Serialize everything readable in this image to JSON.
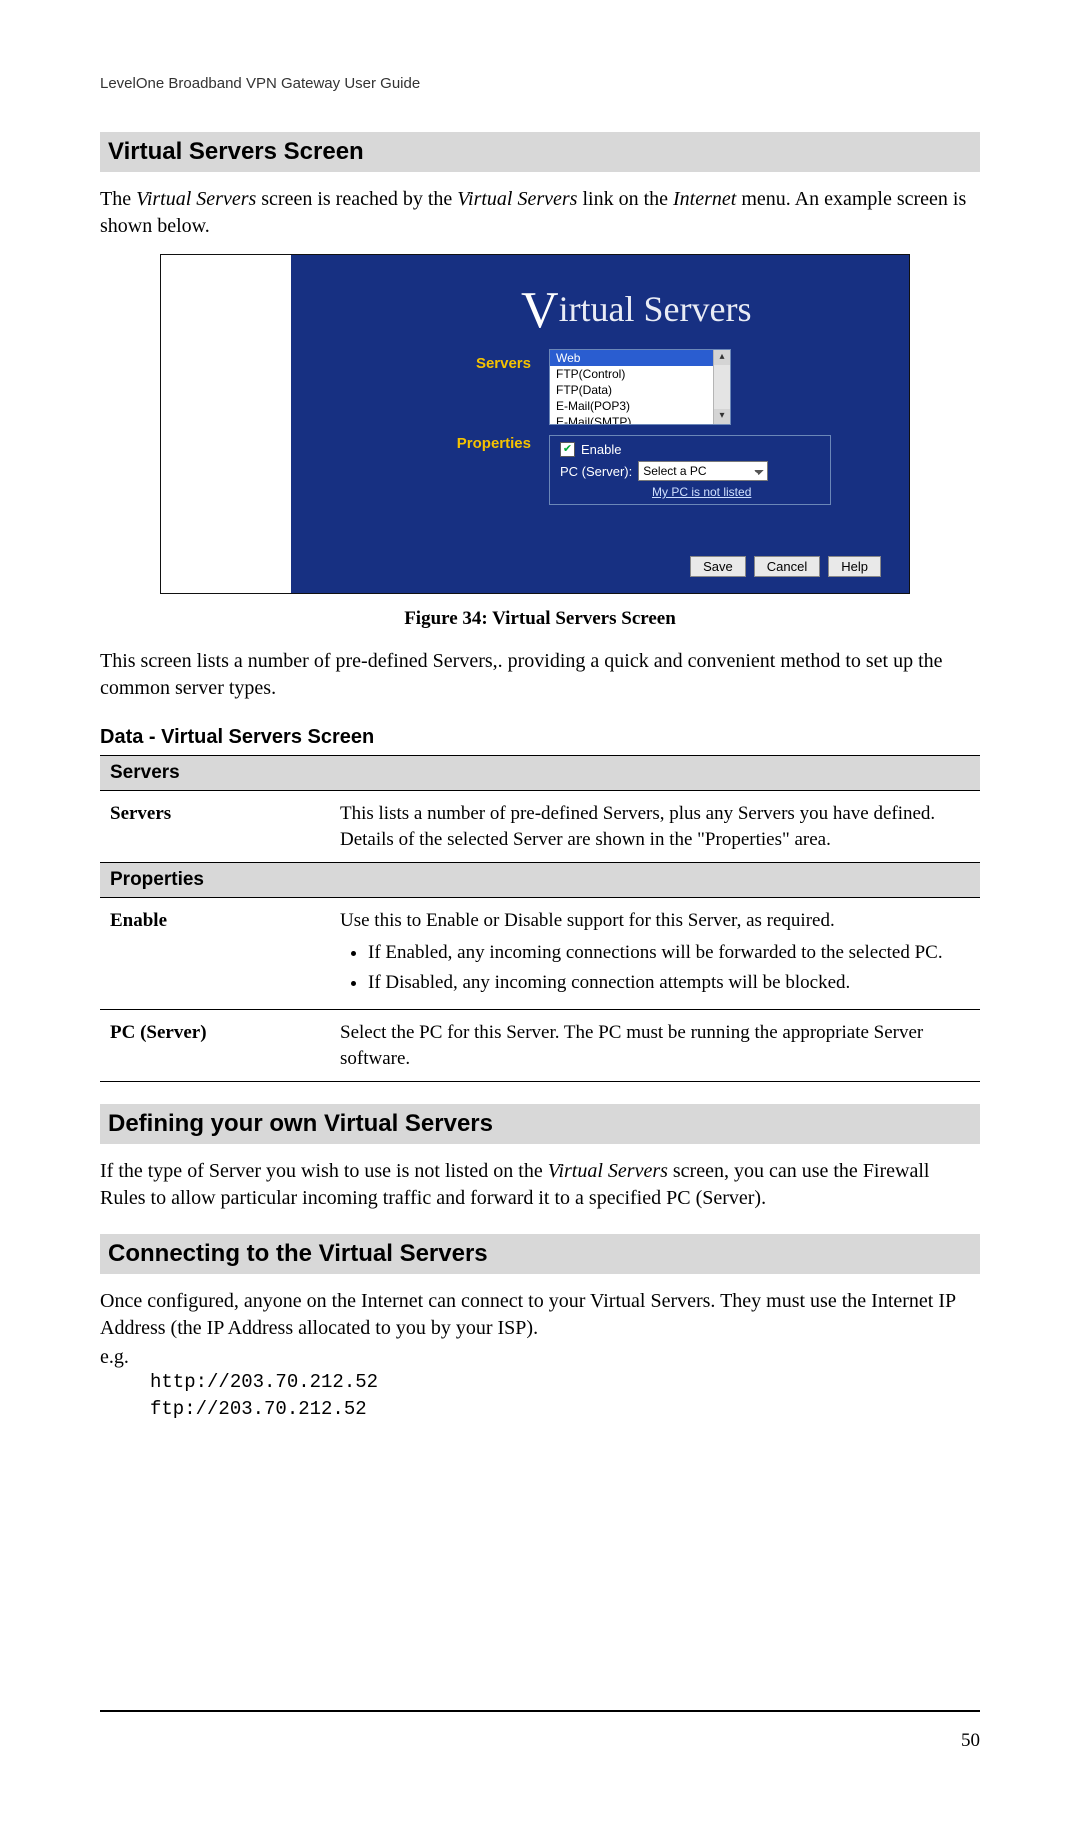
{
  "header": "LevelOne Broadband VPN Gateway User Guide",
  "page_number": "50",
  "sec1": {
    "title": "Virtual Servers Screen",
    "para_pre": "The ",
    "para_i1": "Virtual Servers",
    "para_mid": " screen is reached by the ",
    "para_i2": "Virtual Servers",
    "para_mid2": " link on the ",
    "para_i3": "Internet",
    "para_post": " menu. An example screen is shown below."
  },
  "figure": {
    "title_big": "V",
    "title_rest": "irtual Servers",
    "label_servers": "Servers",
    "label_properties": "Properties",
    "list": {
      "items": [
        "Web",
        "FTP(Control)",
        "FTP(Data)",
        "E-Mail(POP3)",
        "E-Mail(SMTP)"
      ],
      "selected_index": 0
    },
    "props": {
      "enable_label": "Enable",
      "enable_checked": true,
      "pc_label": "PC (Server):",
      "pc_select_value": "Select a PC",
      "not_listed_link": "My PC is not listed"
    },
    "buttons": {
      "save": "Save",
      "cancel": "Cancel",
      "help": "Help"
    },
    "caption": "Figure 34: Virtual Servers Screen"
  },
  "after_fig_para": "This screen lists a number of pre-defined Servers,. providing a quick and convenient method to set up the common server types.",
  "table_title": "Data - Virtual Servers Screen",
  "table": {
    "sec1": "Servers",
    "r1_label": "Servers",
    "r1_text": "This lists a number of pre-defined Servers, plus any Servers you have defined. Details of the selected Server are shown in the \"Properties\" area.",
    "sec2": "Properties",
    "r2_label": "Enable",
    "r2_text": "Use this to Enable or Disable support for this Server, as required.",
    "r2_b1": "If Enabled, any incoming connections will be forwarded to the selected PC.",
    "r2_b2": "If Disabled, any incoming connection attempts will be blocked.",
    "r3_label": "PC (Server)",
    "r3_text": "Select the PC for this Server. The PC must be running the appropriate Server software."
  },
  "sec2": {
    "title": "Defining your own Virtual Servers",
    "para_pre": "If the type of Server you wish to use is not listed on the ",
    "para_i1": "Virtual Servers",
    "para_post": " screen, you can use the Firewall Rules to allow particular incoming traffic and forward it to a specified PC (Server)."
  },
  "sec3": {
    "title": "Connecting to the Virtual Servers",
    "para": "Once configured, anyone on the Internet can connect to your Virtual Servers. They must use the Internet IP Address (the IP Address allocated to you by your ISP).",
    "eg_label": "e.g.",
    "eg1": "http://203.70.212.52",
    "eg2": "ftp://203.70.212.52"
  }
}
